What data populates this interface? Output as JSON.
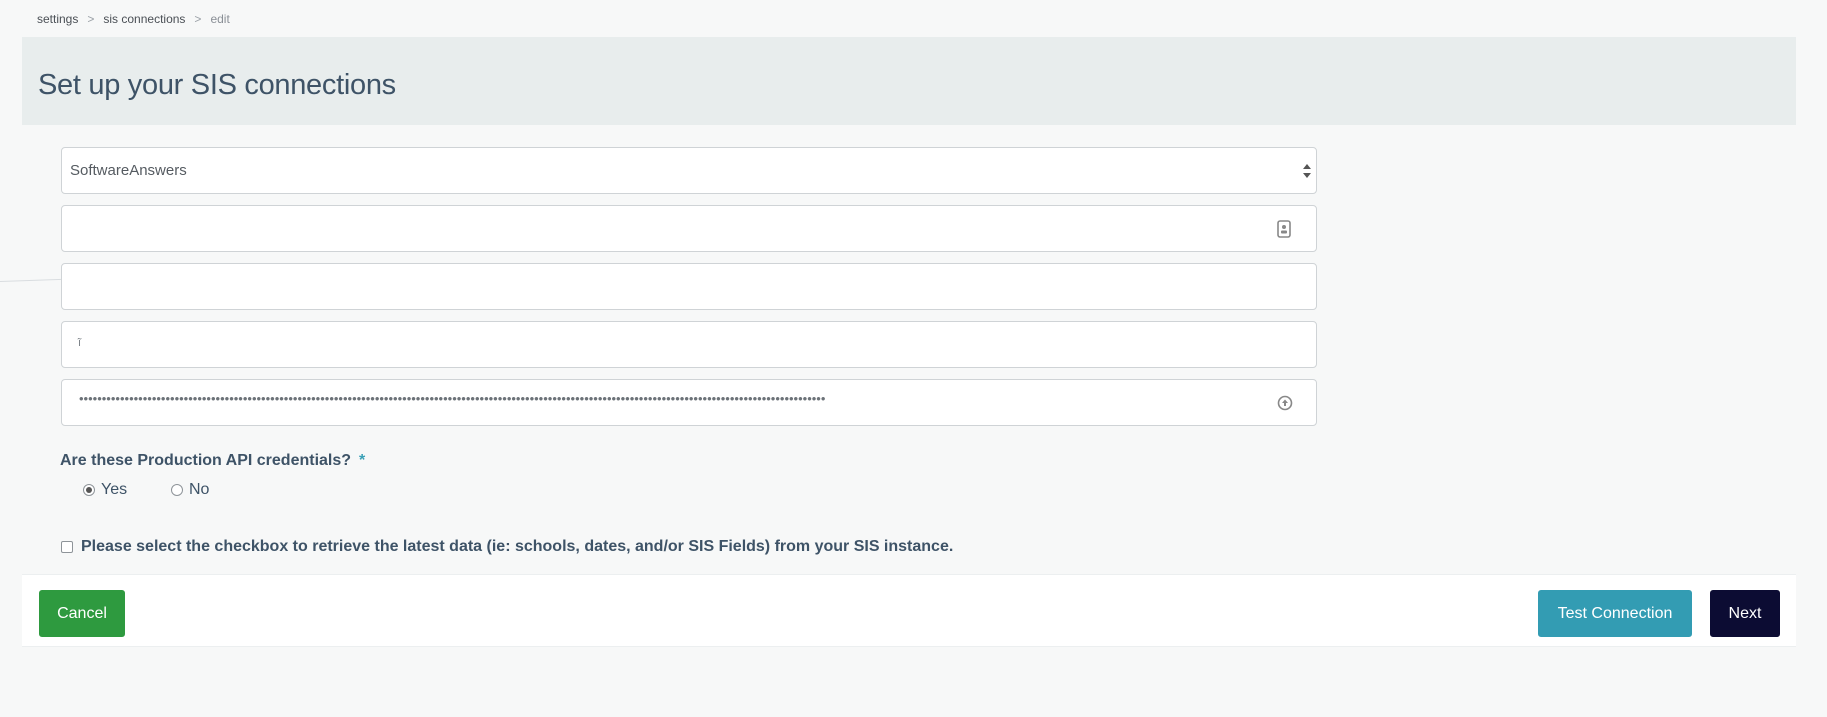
{
  "breadcrumb": {
    "items": [
      "settings",
      "sis connections",
      "edit"
    ],
    "separator": ">"
  },
  "header": {
    "title": "Set up your SIS connections"
  },
  "form": {
    "sis_select": {
      "value": "SoftwareAnswers"
    },
    "field_2": {
      "value": ""
    },
    "field_3": {
      "value": ""
    },
    "field_4": {
      "value": "ĩ"
    },
    "field_5": {
      "masked_value": "••••••••••••••••••••••••••••••••••••••••••••••••••••••••••••••••••••••••••••••••••••••••••••••••••••••••••••••••••••••••••••••••••••••••••••••••••••••••••••••••••••"
    }
  },
  "question": {
    "label": "Are these Production API credentials?",
    "required_mark": "*",
    "options": [
      {
        "label": "Yes",
        "selected": true
      },
      {
        "label": "No",
        "selected": false
      }
    ]
  },
  "checkbox": {
    "label": "Please select the checkbox to retrieve the latest data (ie: schools, dates, and/or SIS Fields) from your SIS instance.",
    "checked": false
  },
  "actions": {
    "cancel_label": "Cancel",
    "test_label": "Test Connection",
    "next_label": "Next"
  },
  "colors": {
    "cancel": "#2e9a3f",
    "test": "#339cb3",
    "next": "#0c0c33",
    "header_band": "#e8eded"
  },
  "icons": {
    "field_2_icon": "contact-card-icon",
    "field_5_icon": "password-reveal-icon"
  }
}
